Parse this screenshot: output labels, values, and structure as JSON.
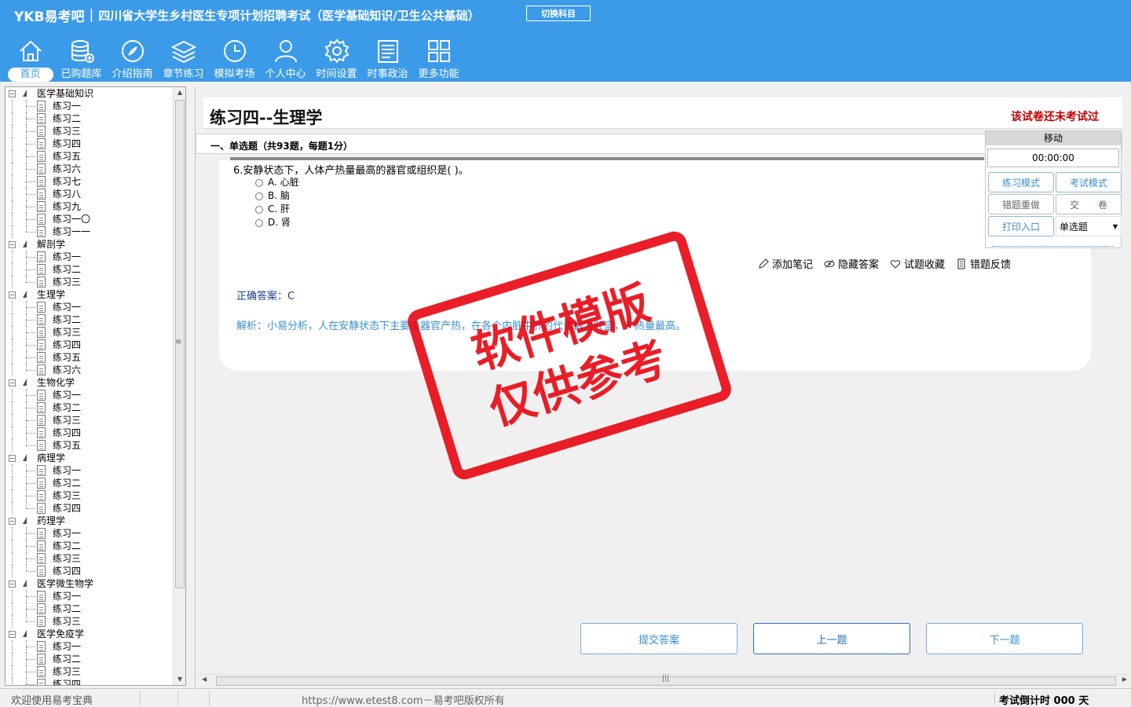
{
  "header": {
    "brand": "YKB易考吧",
    "exam_title": "四川省大学生乡村医生专项计划招聘考试（医学基础知识/卫生公共基础）",
    "switch_label": "切换科目",
    "bg_color": "#3c9be8"
  },
  "nav": [
    {
      "label": "首页",
      "icon": "home-icon",
      "active": true
    },
    {
      "label": "已购题库",
      "icon": "database-icon"
    },
    {
      "label": "介绍指南",
      "icon": "compass-icon"
    },
    {
      "label": "章节练习",
      "icon": "layers-icon"
    },
    {
      "label": "模拟考场",
      "icon": "clock-icon"
    },
    {
      "label": "个人中心",
      "icon": "user-icon"
    },
    {
      "label": "时间设置",
      "icon": "gear-icon"
    },
    {
      "label": "时事政治",
      "icon": "newspaper-icon"
    },
    {
      "label": "更多功能",
      "icon": "grid-icon"
    }
  ],
  "tree": [
    {
      "group": "医学基础知识",
      "items": [
        "练习一",
        "练习二",
        "练习三",
        "练习四",
        "练习五",
        "练习六",
        "练习七",
        "练习八",
        "练习九",
        "练习一〇",
        "练习一一"
      ]
    },
    {
      "group": "解剖学",
      "items": [
        "练习一",
        "练习二",
        "练习三"
      ]
    },
    {
      "group": "生理学",
      "items": [
        "练习一",
        "练习二",
        "练习三",
        "练习四",
        "练习五",
        "练习六"
      ]
    },
    {
      "group": "生物化学",
      "items": [
        "练习一",
        "练习二",
        "练习三",
        "练习四",
        "练习五"
      ]
    },
    {
      "group": "病理学",
      "items": [
        "练习一",
        "练习二",
        "练习三",
        "练习四"
      ]
    },
    {
      "group": "药理学",
      "items": [
        "练习一",
        "练习二",
        "练习三",
        "练习四"
      ]
    },
    {
      "group": "医学微生物学",
      "items": [
        "练习一",
        "练习二",
        "练习三"
      ]
    },
    {
      "group": "医学免疫学",
      "items": [
        "练习一",
        "练习二",
        "练习三",
        "练习四"
      ]
    }
  ],
  "paper": {
    "title": "练习四--生理学",
    "status": "该试卷还未考试过",
    "section": "一、单选题（共93题，每题1分）"
  },
  "question": {
    "text": "6.安静状态下，人体产热量最高的器官或组织是( )。",
    "options": [
      "A. 心脏",
      "B. 脑",
      "C. 肝",
      "D. 肾"
    ],
    "actions": [
      "添加笔记",
      "隐藏答案",
      "试题收藏",
      "错题反馈"
    ],
    "answer": "正确答案：C",
    "analysis": "解析：小易分析，人在安静状态下主要由器官产热，在各个内脏中肝的代谢最为旺盛，产热量最高。"
  },
  "buttons": {
    "submit": "提交答案",
    "prev": "上一题",
    "next": "下一题"
  },
  "panel": {
    "title": "移动",
    "timer": "00:00:00",
    "practice_mode": "练习模式",
    "exam_mode": "考试模式",
    "redo_wrong": "错题重做",
    "hand_in": "交　　卷",
    "print": "打印入口",
    "type_select": "单选题"
  },
  "watermark": {
    "line1": "软件模版",
    "line2": "仅供参考",
    "color": "#e8000b"
  },
  "status": {
    "welcome": "欢迎使用易考宝典",
    "url": "https://www.etest8.com－易考吧版权所有",
    "countdown": "考试倒计时 000 天"
  }
}
